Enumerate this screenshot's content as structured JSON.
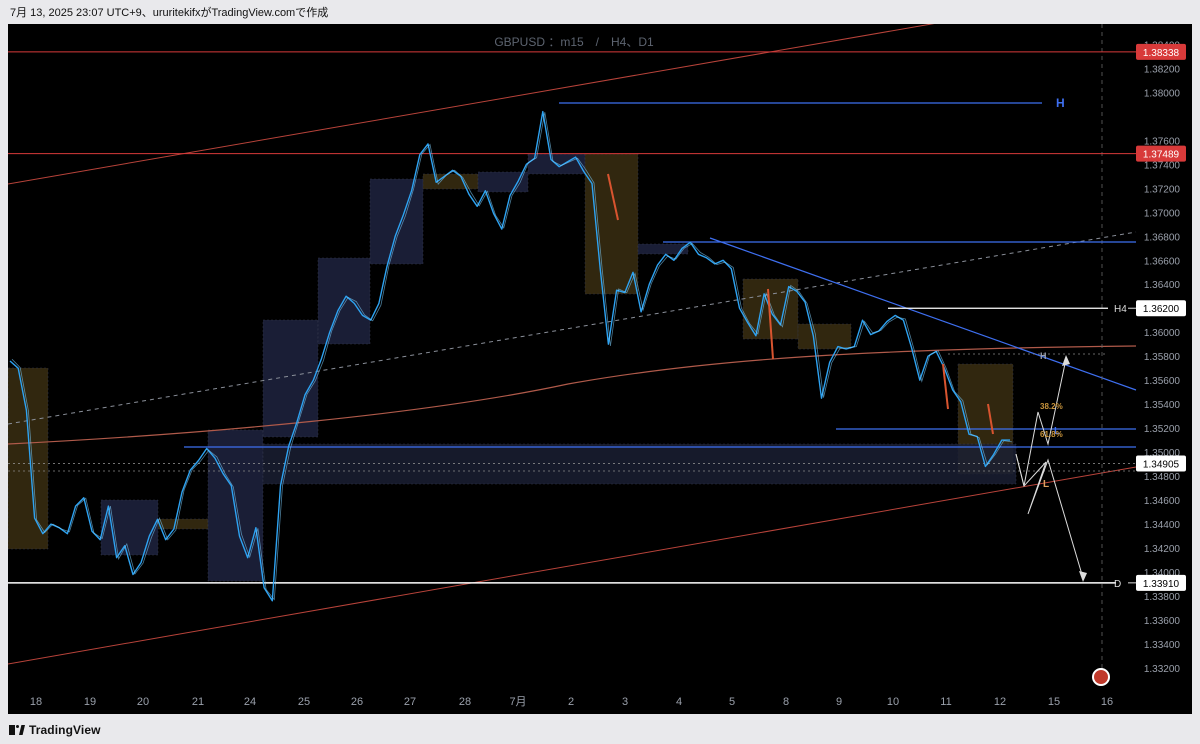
{
  "header": {
    "timestamp_text": "7月 13, 2025 23:07 UTC+9、ururitekifxがTradingView.comで作成"
  },
  "footer": {
    "brand": "TradingView"
  },
  "chart_data": {
    "type": "line",
    "title": "GBPUSD ：m15　/　H4、D1",
    "symbol": "GBPUSD",
    "x_tick_labels": [
      "18",
      "19",
      "20",
      "21",
      "24",
      "25",
      "26",
      "27",
      "28",
      "7月",
      "2",
      "3",
      "4",
      "5",
      "8",
      "9",
      "10",
      "11",
      "12",
      "15",
      "16"
    ],
    "y_tick_labels": [
      "1.38400",
      "1.38200",
      "1.38000",
      "1.37600",
      "1.37400",
      "1.37200",
      "1.37000",
      "1.36800",
      "1.36600",
      "1.36400",
      "1.36000",
      "1.35800",
      "1.35600",
      "1.35400",
      "1.35200",
      "1.35000",
      "1.34800",
      "1.34600",
      "1.34400",
      "1.34200",
      "1.34000",
      "1.33800",
      "1.33600",
      "1.33400",
      "1.33200"
    ],
    "ylim": [
      1.3315,
      1.3847
    ],
    "grid": false,
    "highlighted_levels": [
      {
        "label": "1.38338",
        "value": 1.38338,
        "color": "#d83a3a",
        "prefix": ""
      },
      {
        "label": "1.37489",
        "value": 1.37489,
        "color": "#d83a3a",
        "prefix": ""
      },
      {
        "label": "1.36200",
        "value": 1.362,
        "color": "#ffffff",
        "prefix": "H4"
      },
      {
        "label": "1.34905",
        "value": 1.34905,
        "color": "#ffffff",
        "prefix": ""
      },
      {
        "label": "1.33910",
        "value": 1.3391,
        "color": "#ffffff",
        "prefix": "D"
      }
    ],
    "annotations": [
      {
        "text": "H",
        "color": "#3e6ff0"
      },
      {
        "text": "H",
        "color": "#9aa0b0"
      },
      {
        "text": "L",
        "color": "#3e6ff0"
      },
      {
        "text": "L",
        "color": "#e0a060"
      },
      {
        "text": "38.2%",
        "color": "#c8943c"
      },
      {
        "text": "61.8%",
        "color": "#c8943c"
      }
    ],
    "series": [
      {
        "color": "#2ea3f2",
        "points": [
          [
            0,
            1.3576
          ],
          [
            1,
            1.357
          ],
          [
            2,
            1.3535
          ],
          [
            3,
            1.3445
          ],
          [
            4,
            1.3432
          ],
          [
            5,
            1.344
          ],
          [
            6,
            1.3437
          ],
          [
            7,
            1.3432
          ],
          [
            8,
            1.3455
          ],
          [
            9,
            1.3462
          ],
          [
            10,
            1.3434
          ],
          [
            11,
            1.3427
          ],
          [
            12,
            1.3455
          ],
          [
            13,
            1.3412
          ],
          [
            14,
            1.3422
          ],
          [
            15,
            1.3398
          ],
          [
            16,
            1.3408
          ],
          [
            17,
            1.343
          ],
          [
            18,
            1.3444
          ],
          [
            19,
            1.3427
          ],
          [
            20,
            1.3436
          ],
          [
            21,
            1.3467
          ],
          [
            22,
            1.3485
          ],
          [
            23,
            1.3493
          ],
          [
            24,
            1.3503
          ],
          [
            25,
            1.3495
          ],
          [
            26,
            1.3482
          ],
          [
            27,
            1.3472
          ],
          [
            28,
            1.343
          ],
          [
            29,
            1.3412
          ],
          [
            30,
            1.3437
          ],
          [
            31,
            1.3387
          ],
          [
            32,
            1.3376
          ],
          [
            33,
            1.3472
          ],
          [
            34,
            1.3505
          ],
          [
            35,
            1.3525
          ],
          [
            36,
            1.3548
          ],
          [
            37,
            1.356
          ],
          [
            38,
            1.3578
          ],
          [
            39,
            1.36
          ],
          [
            40,
            1.3618
          ],
          [
            41,
            1.363
          ],
          [
            42,
            1.3624
          ],
          [
            43,
            1.3614
          ],
          [
            44,
            1.361
          ],
          [
            45,
            1.3624
          ],
          [
            46,
            1.3655
          ],
          [
            47,
            1.368
          ],
          [
            48,
            1.3698
          ],
          [
            49,
            1.3718
          ],
          [
            50,
            1.3748
          ],
          [
            51,
            1.3757
          ],
          [
            52,
            1.3725
          ],
          [
            53,
            1.373
          ],
          [
            54,
            1.3735
          ],
          [
            55,
            1.373
          ],
          [
            56,
            1.3715
          ],
          [
            57,
            1.3705
          ],
          [
            58,
            1.3718
          ],
          [
            59,
            1.3699
          ],
          [
            60,
            1.3686
          ],
          [
            61,
            1.3714
          ],
          [
            62,
            1.3726
          ],
          [
            63,
            1.374
          ],
          [
            64,
            1.3745
          ],
          [
            65,
            1.3784
          ],
          [
            66,
            1.3744
          ],
          [
            67,
            1.3738
          ],
          [
            68,
            1.3742
          ],
          [
            69,
            1.3746
          ],
          [
            70,
            1.3734
          ],
          [
            71,
            1.3724
          ],
          [
            72,
            1.3653
          ],
          [
            73,
            1.359
          ],
          [
            74,
            1.3635
          ],
          [
            75,
            1.3633
          ],
          [
            76,
            1.365
          ],
          [
            77,
            1.3617
          ],
          [
            78,
            1.364
          ],
          [
            79,
            1.3656
          ],
          [
            80,
            1.3665
          ],
          [
            81,
            1.366
          ],
          [
            82,
            1.367
          ],
          [
            83,
            1.3675
          ],
          [
            84,
            1.3665
          ],
          [
            85,
            1.3662
          ],
          [
            86,
            1.3657
          ],
          [
            87,
            1.366
          ],
          [
            88,
            1.3653
          ],
          [
            89,
            1.362
          ],
          [
            90,
            1.3608
          ],
          [
            91,
            1.3597
          ],
          [
            92,
            1.3632
          ],
          [
            93,
            1.3615
          ],
          [
            94,
            1.3606
          ],
          [
            95,
            1.3638
          ],
          [
            96,
            1.3634
          ],
          [
            97,
            1.3625
          ],
          [
            98,
            1.3597
          ],
          [
            99,
            1.3545
          ],
          [
            100,
            1.3575
          ],
          [
            101,
            1.3588
          ],
          [
            102,
            1.3586
          ],
          [
            103,
            1.3588
          ],
          [
            104,
            1.361
          ],
          [
            105,
            1.3598
          ],
          [
            106,
            1.3601
          ],
          [
            107,
            1.3609
          ],
          [
            108,
            1.3614
          ],
          [
            109,
            1.361
          ],
          [
            110,
            1.3587
          ],
          [
            111,
            1.356
          ],
          [
            112,
            1.358
          ],
          [
            113,
            1.3584
          ],
          [
            114,
            1.357
          ],
          [
            115,
            1.3552
          ],
          [
            116,
            1.3542
          ],
          [
            117,
            1.3515
          ],
          [
            118,
            1.3513
          ],
          [
            119,
            1.3488
          ],
          [
            120,
            1.3498
          ],
          [
            121,
            1.351
          ],
          [
            122,
            1.351
          ]
        ]
      }
    ]
  }
}
